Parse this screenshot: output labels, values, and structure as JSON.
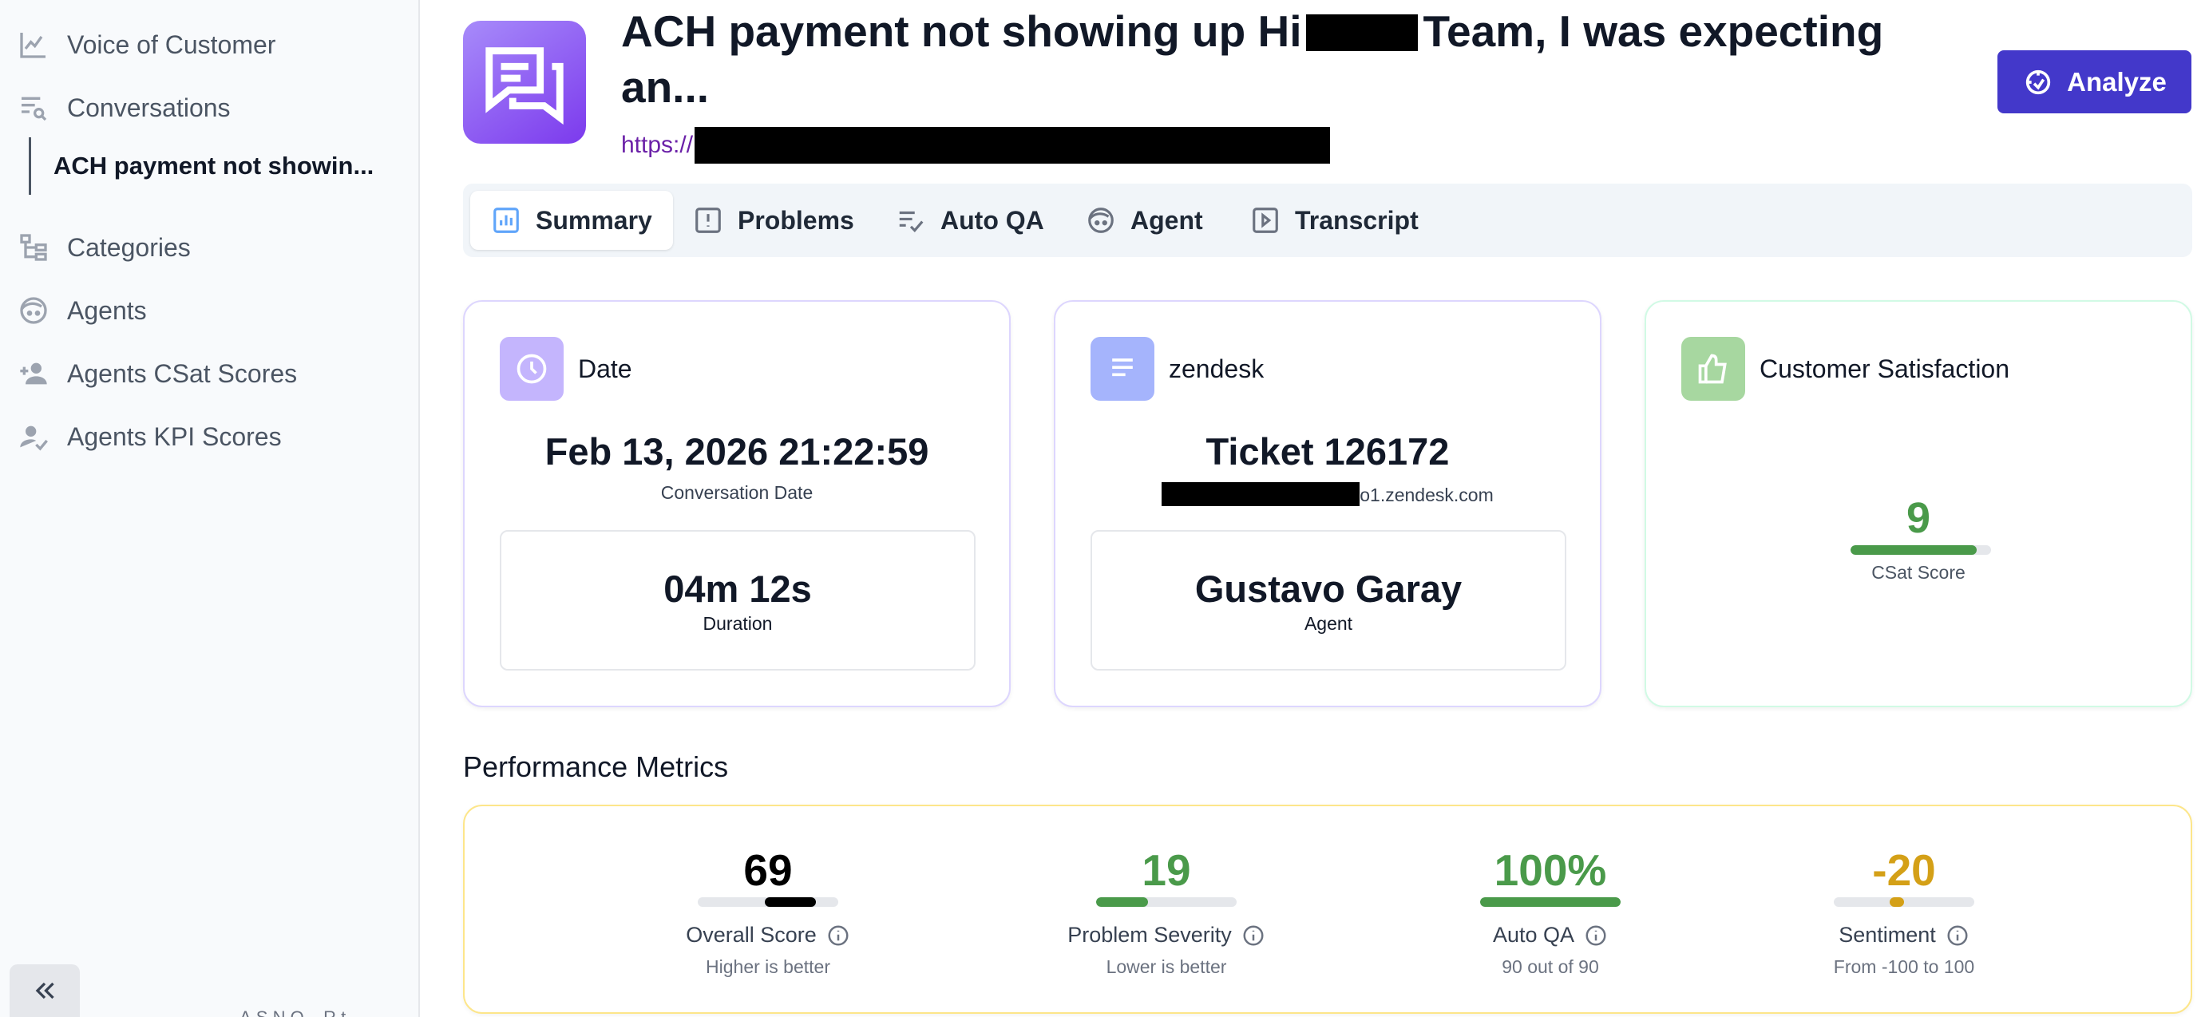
{
  "sidebar": {
    "items": [
      {
        "label": "Voice of Customer",
        "icon": "chart-line-icon"
      },
      {
        "label": "Conversations",
        "icon": "list-search-icon"
      },
      {
        "label": "Categories",
        "icon": "hierarchy-icon"
      },
      {
        "label": "Agents",
        "icon": "agent-face-icon"
      },
      {
        "label": "Agents CSat Scores",
        "icon": "user-plus-icon"
      },
      {
        "label": "Agents KPI Scores",
        "icon": "user-check-icon"
      }
    ],
    "active_sub_item": "ACH payment not showin...",
    "footer_text": "A.S.N.O... R.t..."
  },
  "header": {
    "title_part1": "ACH payment not showing up Hi",
    "title_part2": "Team, I was expecting an...",
    "url_prefix": "https://",
    "analyze_label": "Analyze",
    "brand_color": "#4338ca"
  },
  "tabs": [
    {
      "label": "Summary",
      "icon": "bar-chart-icon",
      "active": true
    },
    {
      "label": "Problems",
      "icon": "alert-square-icon"
    },
    {
      "label": "Auto QA",
      "icon": "list-check-icon"
    },
    {
      "label": "Agent",
      "icon": "agent-face-icon"
    },
    {
      "label": "Transcript",
      "icon": "play-square-icon"
    }
  ],
  "cards": {
    "date": {
      "title": "Date",
      "value": "Feb 13, 2026 21:22:59",
      "value_label": "Conversation Date",
      "duration": "04m 12s",
      "duration_label": "Duration",
      "icon_color": "#c4b5fd"
    },
    "source": {
      "title": "zendesk",
      "ticket": "Ticket 126172",
      "host_suffix": "o1.zendesk.com",
      "agent_name": "Gustavo Garay",
      "agent_label": "Agent",
      "icon_color": "#a5b4fc"
    },
    "csat": {
      "title": "Customer Satisfaction",
      "score": "9",
      "score_fraction": 0.9,
      "score_label": "CSat Score",
      "icon_color": "#a7d7a0"
    }
  },
  "performance": {
    "title": "Performance Metrics",
    "metrics": [
      {
        "value": "69",
        "label": "Overall Score",
        "sub": "Higher is better",
        "color": "#000000",
        "fill_from": 0.48,
        "fill_to": 0.84
      },
      {
        "value": "19",
        "label": "Problem Severity",
        "sub": "Lower is better",
        "color": "#4a9a4a",
        "fill_from": 0.0,
        "fill_to": 0.37
      },
      {
        "value": "100%",
        "label": "Auto QA",
        "sub": "90 out of 90",
        "color": "#4a9a4a",
        "fill_from": 0.0,
        "fill_to": 1.0
      },
      {
        "value": "-20",
        "label": "Sentiment",
        "sub": "From -100 to 100",
        "color": "#d4a017",
        "fill_from": 0.4,
        "fill_to": 0.5
      }
    ]
  }
}
